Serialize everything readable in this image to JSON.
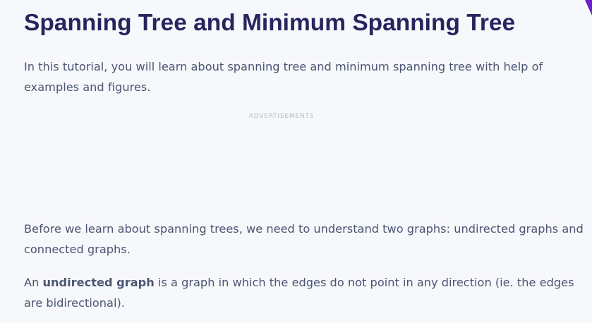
{
  "article": {
    "title": "Spanning Tree and Minimum Spanning Tree",
    "intro": "In this tutorial, you will learn about spanning tree and minimum spanning tree with help of examples and figures.",
    "advertisements_label": "ADVERTISEMENTS",
    "paragraph_1": "Before we learn about spanning trees, we need to understand two graphs: undirected graphs and connected graphs.",
    "paragraph_2": {
      "lead": "An ",
      "term": "undirected graph",
      "rest": " is a graph in which the edges do not point in any direction (ie. the edges are bidirectional)."
    }
  },
  "colors": {
    "background": "#f7f8fb",
    "heading": "#25265e",
    "body_text": "#4b5573",
    "muted": "#b4bac6",
    "accent": "#6b1fd1"
  }
}
